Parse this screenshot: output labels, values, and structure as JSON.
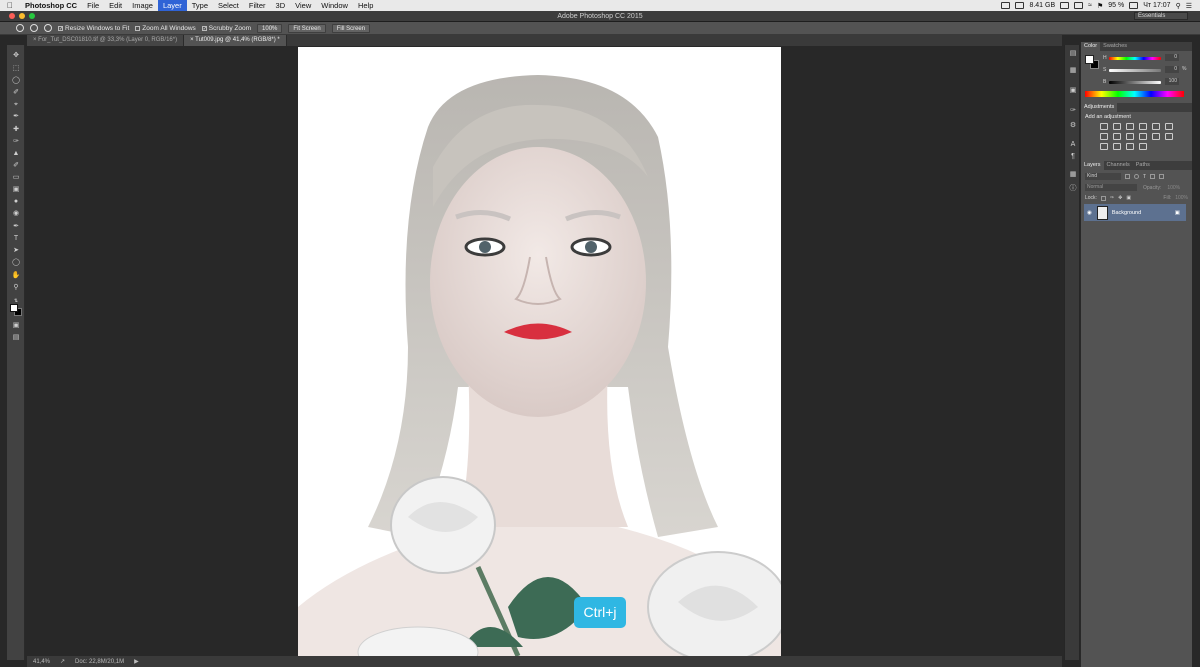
{
  "menubar": {
    "app_name": "Photoshop CC",
    "items": [
      "File",
      "Edit",
      "Image",
      "Layer",
      "Type",
      "Select",
      "Filter",
      "3D",
      "View",
      "Window",
      "Help"
    ],
    "active_item": "Layer",
    "status": {
      "memory": "8.41 GB",
      "battery": "95 %",
      "clock": "Чт 17:07"
    }
  },
  "titlebar": {
    "title": "Adobe Photoshop CC 2015",
    "workspace": "Essentials"
  },
  "options": {
    "resize_windows": "Resize Windows to Fit",
    "zoom_all": "Zoom All Windows",
    "scrubby": "Scrubby Zoom",
    "zoom_100": "100%",
    "fit_screen": "Fit Screen",
    "fill_screen": "Fill Screen"
  },
  "tabs": [
    {
      "label": "For_Tut_DSC01810.tif @ 33,3% (Layer 0, RGB/16*)"
    },
    {
      "label": "Tut009.jpg @ 41,4% (RGB/8*) *"
    }
  ],
  "statusbar": {
    "zoom": "41,4%",
    "doc": "Doc: 22,8M/20,1M"
  },
  "shortcut": "Ctrl+j",
  "color_panel": {
    "tab_color": "Color",
    "tab_swatches": "Swatches",
    "r_value": "0",
    "g_value": "0",
    "b_value": "100",
    "s_label": "S",
    "b_label": "B",
    "h_label": "H",
    "percent": "%"
  },
  "adjustments": {
    "tab": "Adjustments",
    "heading": "Add an adjustment"
  },
  "layers": {
    "tab_layers": "Layers",
    "tab_channels": "Channels",
    "tab_paths": "Paths",
    "kind": "Kind",
    "blend_mode": "Normal",
    "opacity_label": "Opacity:",
    "opacity_value": "100%",
    "lock_label": "Lock:",
    "fill_label": "Fill:",
    "fill_value": "100%",
    "background_layer": "Background"
  },
  "colors": {
    "menubar_bg": "#e9e9e9",
    "accent_blue": "#2f63d6",
    "shortcut_badge": "#2fb7e3",
    "layer_selected": "#5d7190"
  }
}
